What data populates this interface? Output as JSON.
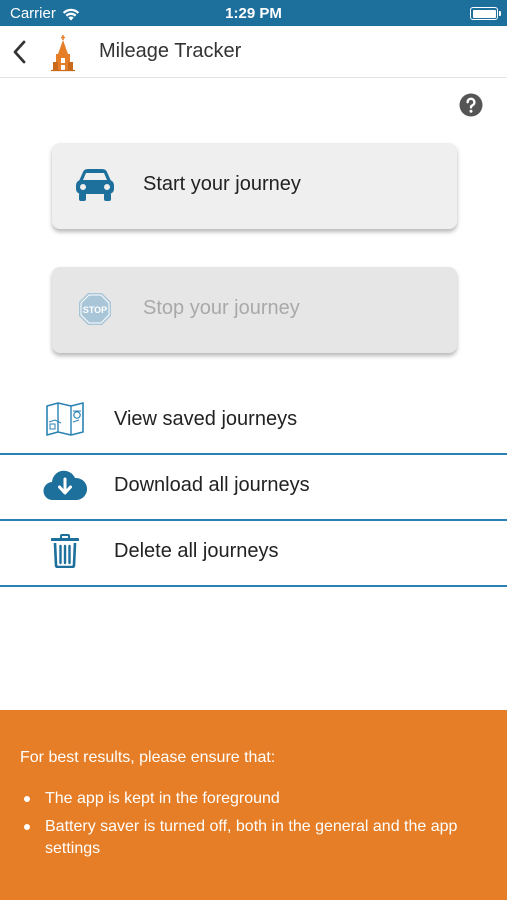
{
  "status_bar": {
    "carrier": "Carrier",
    "time": "1:29 PM"
  },
  "nav": {
    "title": "Mileage Tracker",
    "back_icon": "chevron-left-icon",
    "logo_icon": "church-logo-icon"
  },
  "help_icon": "question-circle-icon",
  "actions": {
    "start": {
      "label": "Start your journey",
      "icon": "car-icon",
      "enabled": true
    },
    "stop": {
      "label": "Stop your journey",
      "icon": "stop-sign-icon",
      "icon_text": "STOP",
      "enabled": false
    }
  },
  "menu": [
    {
      "label": "View saved journeys",
      "icon": "map-icon"
    },
    {
      "label": "Download all journeys",
      "icon": "cloud-download-icon"
    },
    {
      "label": "Delete all journeys",
      "icon": "trash-icon"
    }
  ],
  "tips": {
    "intro": "For best results, please ensure that:",
    "items": [
      "The app is kept in the foreground",
      "Battery saver is turned off, both in the general and the app settings"
    ]
  },
  "colors": {
    "primary": "#1d6f9c",
    "accent": "#e57e27",
    "divider": "#2a82b3",
    "button_bg": "#efefef"
  }
}
